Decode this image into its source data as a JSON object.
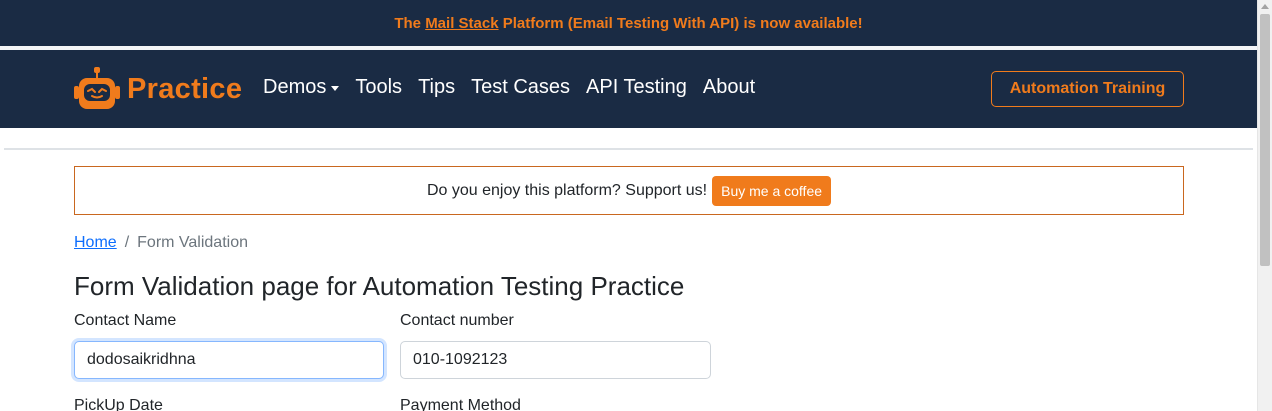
{
  "announcement": {
    "prefix": "The ",
    "link": "Mail Stack",
    "suffix": " Platform (Email Testing With API) is now available!"
  },
  "navbar": {
    "brand": "Practice",
    "brand_icon": "robot-icon",
    "links": [
      "Demos",
      "Tools",
      "Tips",
      "Test Cases",
      "API Testing",
      "About"
    ],
    "training_button": "Automation Training"
  },
  "support": {
    "text": "Do you enjoy this platform? Support us!",
    "button": "Buy me a coffee"
  },
  "breadcrumb": {
    "home": "Home",
    "separator": "/",
    "current": "Form Validation"
  },
  "page_title": "Form Validation page for Automation Testing Practice",
  "form": {
    "contact_name_label": "Contact Name",
    "contact_name_value": "dodosaikridhna",
    "contact_number_label": "Contact number",
    "contact_number_value": "010-1092123",
    "pickup_date_label": "PickUp Date",
    "payment_method_label": "Payment Method"
  },
  "colors": {
    "navy": "#1a2b44",
    "accent": "#f07b1c",
    "link": "#0d6efd"
  }
}
